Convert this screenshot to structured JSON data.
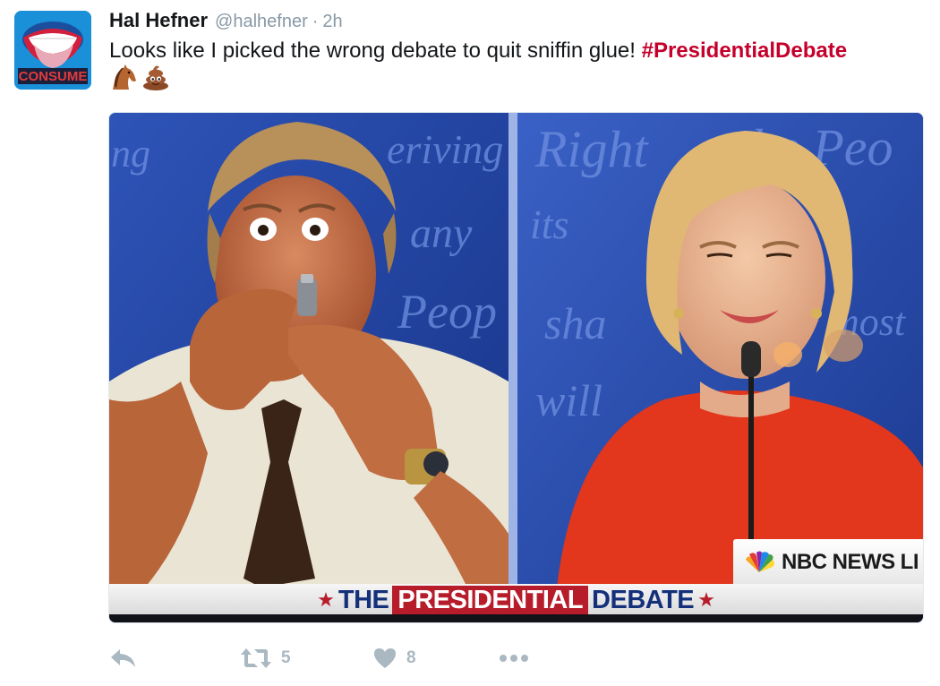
{
  "user": {
    "display_name": "Hal Hefner",
    "handle": "@halhefner",
    "separator": "·",
    "timestamp": "2h",
    "avatar_text": "CONSUME"
  },
  "tweet": {
    "text": "Looks like I picked the wrong debate to quit sniffin glue! ",
    "hashtag": "#PresidentialDebate",
    "emojis": [
      "horse-emoji",
      "pile-of-poo-emoji"
    ]
  },
  "media": {
    "description_icons": [
      "nbc-peacock-icon"
    ],
    "nbc_label": "NBC NEWS",
    "nbc_cut": "LI",
    "lower_third_prefix": "THE",
    "lower_third_highlight": "PRESIDENTIAL",
    "lower_third_suffix": "DEBATE",
    "lower_third_star": "★",
    "backdrop_words": [
      "Right",
      "the Peo",
      "ng",
      "eriving",
      "any",
      "its",
      "Peop",
      "sha",
      "most",
      "will"
    ]
  },
  "actions": {
    "reply_icon": "reply-icon",
    "retweet_icon": "retweet-icon",
    "retweet_count": "5",
    "like_icon": "heart-icon",
    "like_count": "8",
    "more_icon": "more-icon"
  },
  "colors": {
    "hashtag": "#c4002b",
    "muted": "#8899a6",
    "action_icon": "#aab8c2",
    "backdrop_blue": "#1f3d9b",
    "red_banner": "#b71c2b",
    "navy_text": "#14307a"
  }
}
